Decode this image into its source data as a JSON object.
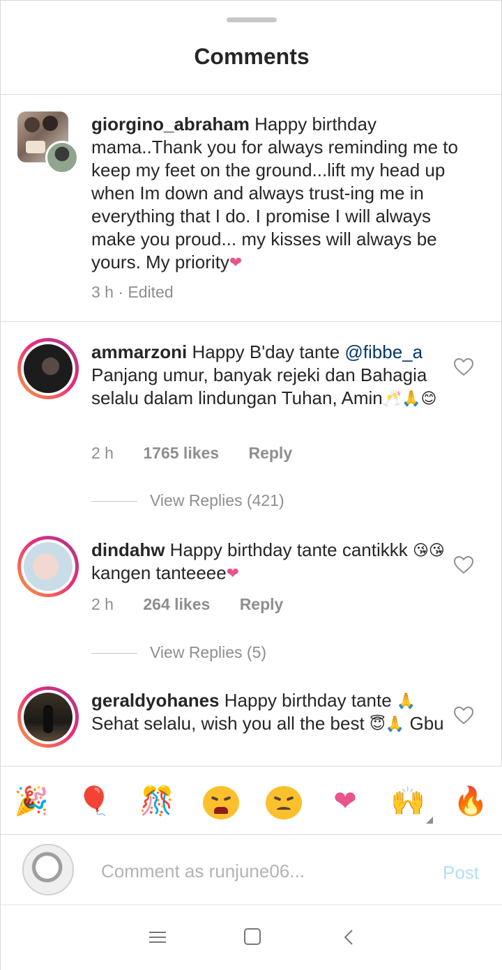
{
  "header": {
    "title": "Comments"
  },
  "caption": {
    "username": "giorgino_abraham",
    "text": "Happy birthday mama..Thank you for always reminding me to  keep my feet on the ground...lift my head up when Im down and always trust-ing me in everything that I do. I promise I will always make you proud... my kisses will always be yours. My priority",
    "emoji": "❤",
    "meta": "3 h · Edited"
  },
  "comments": [
    {
      "username": "ammarzoni",
      "text_before": "Happy B'day tante",
      "mention": "@fibbe_a",
      "text_after": "Panjang umur, banyak rejeki dan Bahagia selalu dalam lindungan Tuhan, Amin",
      "emoji": "🥂🙏😊",
      "time": "2 h",
      "likes": "1765 likes",
      "reply": "Reply",
      "view_replies": "View Replies (421)"
    },
    {
      "username": "dindahw",
      "text": "Happy birthday tante cantikkk",
      "emoji_mid": "😘😘",
      "text_after": "kangen tanteeee",
      "emoji_end": "❤",
      "time": "2 h",
      "likes": "264 likes",
      "reply": "Reply",
      "view_replies": "View Replies (5)"
    },
    {
      "username": "geraldyohanes",
      "text": "Happy birthday tante",
      "emoji1": "🙏",
      "text2": "Sehat selalu, wish you all the best",
      "emoji2": "😇🙏",
      "text3": "Gbu"
    }
  ],
  "emoji_bar": {
    "items": [
      "🎉",
      "🎈",
      "🎊",
      "😫",
      "😣",
      "❤",
      "🙌",
      "🔥"
    ],
    "colors": {
      "balloon": "#f4511e",
      "heart": "#e8558a",
      "face": "#fbc02d",
      "fire": "#ff5722"
    }
  },
  "input": {
    "placeholder": "Comment as runjune06...",
    "post_label": "Post"
  },
  "colors": {
    "mention": "#00376b",
    "muted": "#8e8e8e",
    "post_disabled": "#b2dffc"
  }
}
